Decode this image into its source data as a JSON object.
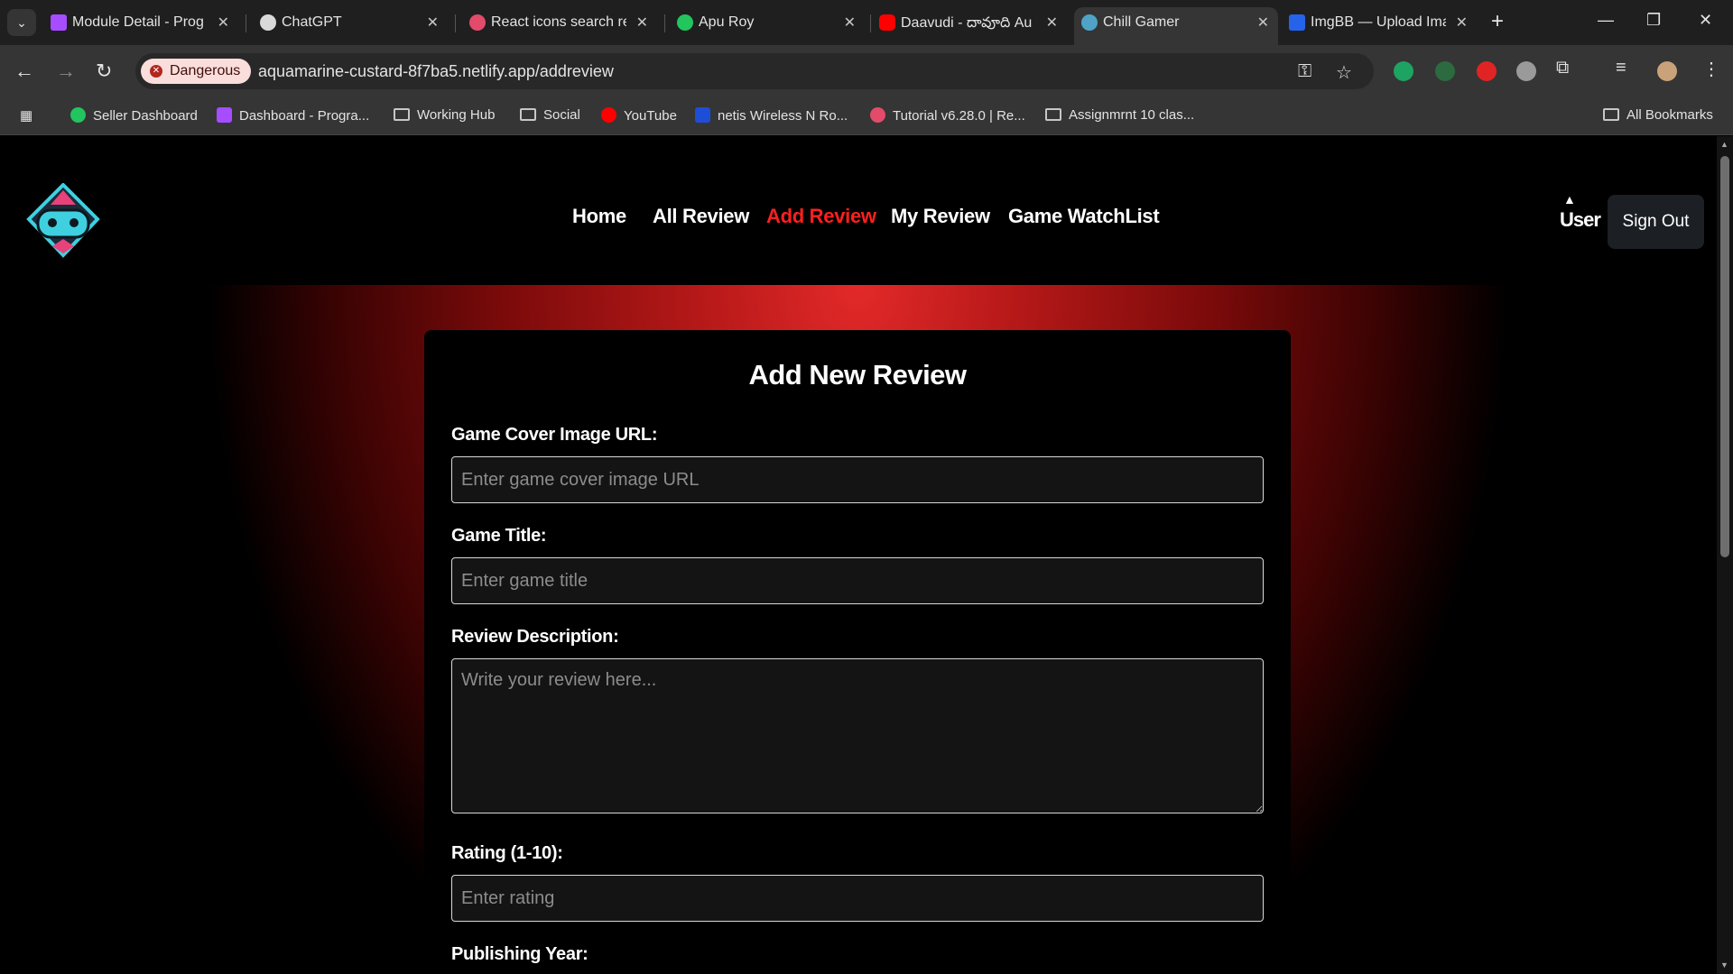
{
  "browser": {
    "tabs": [
      {
        "title": "Module Detail - Prog",
        "favicon_color": "#a64dff"
      },
      {
        "title": "ChatGPT",
        "favicon_color": "#d9d9d9"
      },
      {
        "title": "React icons search re",
        "favicon_color": "#e34b6b"
      },
      {
        "title": "Apu Roy",
        "favicon_color": "#22c55e"
      },
      {
        "title": "Daavudi - దావూది Au",
        "favicon_color": "#ff0000"
      },
      {
        "title": "Chill Gamer",
        "favicon_color": "#4fa3c7"
      },
      {
        "title": "ImgBB — Upload Ima",
        "favicon_color": "#2563eb"
      }
    ],
    "active_tab_index": 5,
    "security_label": "Dangerous",
    "url": "aquamarine-custard-8f7ba5.netlify.app/addreview",
    "bookmarks": [
      {
        "label": "Seller Dashboard",
        "type": "site",
        "color": "#22c55e"
      },
      {
        "label": "Dashboard - Progra...",
        "type": "site",
        "color": "#a64dff"
      },
      {
        "label": "Working Hub",
        "type": "folder"
      },
      {
        "label": "Social",
        "type": "folder"
      },
      {
        "label": "YouTube",
        "type": "site",
        "color": "#ff0000"
      },
      {
        "label": "netis Wireless N Ro...",
        "type": "site",
        "color": "#1d4ed8"
      },
      {
        "label": "Tutorial v6.28.0 | Re...",
        "type": "site",
        "color": "#e34b6b"
      },
      {
        "label": "Assignmrnt 10 clas...",
        "type": "folder"
      }
    ],
    "all_bookmarks_label": "All Bookmarks"
  },
  "site": {
    "nav": {
      "items": [
        "Home",
        "All Review",
        "Add Review",
        "My Review",
        "Game WatchList"
      ],
      "active_index": 2
    },
    "user_alt": "User",
    "signout_label": "Sign Out",
    "accent_color": "#ff1f1f"
  },
  "form": {
    "title": "Add New Review",
    "cover_label": "Game Cover Image URL:",
    "cover_placeholder": "Enter game cover image URL",
    "title_label": "Game Title:",
    "title_placeholder": "Enter game title",
    "desc_label": "Review Description:",
    "desc_placeholder": "Write your review here...",
    "rating_label": "Rating (1-10):",
    "rating_placeholder": "Enter rating",
    "year_label": "Publishing Year:"
  }
}
